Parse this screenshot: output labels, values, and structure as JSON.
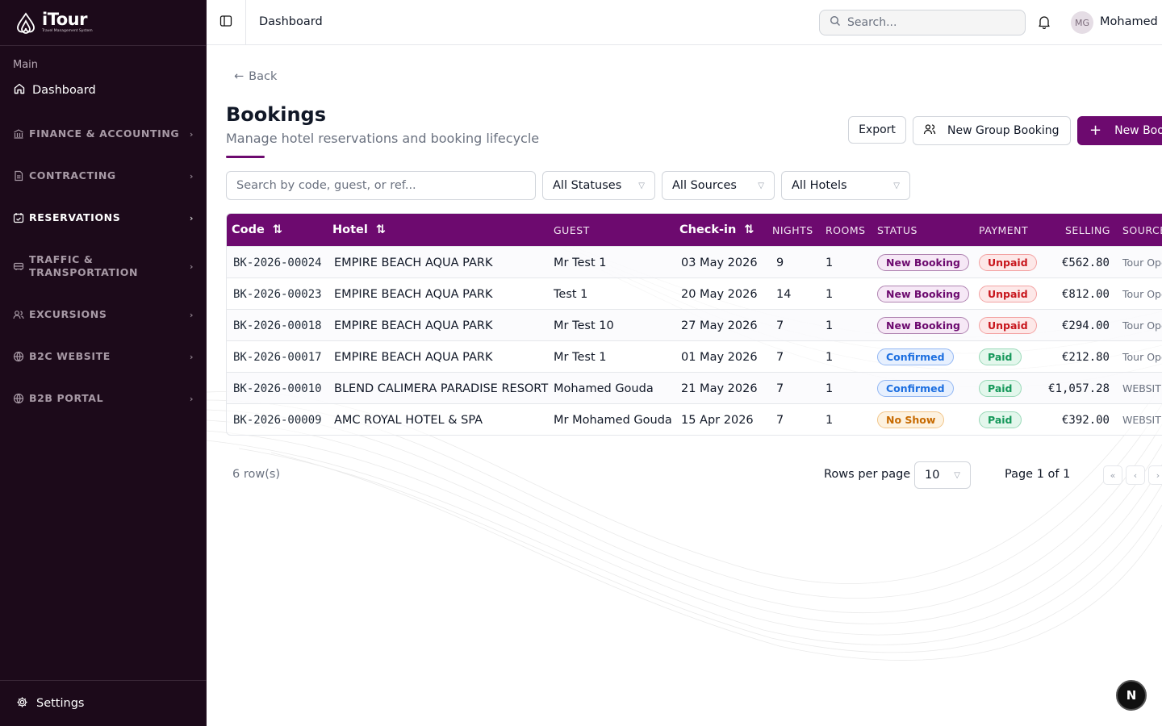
{
  "brand": {
    "name": "iTour",
    "tagline": "Travel Management System"
  },
  "sidebar": {
    "section_label": "Main",
    "dashboard_label": "Dashboard",
    "groups": [
      {
        "label": "FINANCE & ACCOUNTING",
        "icon": "bank-icon"
      },
      {
        "label": "CONTRACTING",
        "icon": "file-icon"
      },
      {
        "label": "RESERVATIONS",
        "icon": "calendar-check-icon"
      },
      {
        "label": "TRAFFIC &\nTRANSPORTATION",
        "icon": "bus-icon"
      },
      {
        "label": "EXCURSIONS",
        "icon": "users-icon"
      },
      {
        "label": "B2C WEBSITE",
        "icon": "globe-icon"
      },
      {
        "label": "B2B PORTAL",
        "icon": "globe-icon"
      }
    ],
    "settings_label": "Settings"
  },
  "header": {
    "breadcrumb": "Dashboard",
    "search_placeholder": "Search...",
    "avatar_initials": "MG",
    "user_name": "Mohamed Gouda"
  },
  "page": {
    "back_label": "Back",
    "title": "Bookings",
    "subtitle": "Manage hotel reservations and booking lifecycle",
    "export_label": "Export",
    "group_booking_label": "New Group Booking",
    "new_booking_label": "New Booking"
  },
  "filters": {
    "search_placeholder": "Search by code, guest, or ref...",
    "status": "All Statuses",
    "source": "All Sources",
    "hotel": "All Hotels"
  },
  "table": {
    "columns": {
      "code": "Code",
      "hotel": "Hotel",
      "guest": "GUEST",
      "checkin": "Check-in",
      "nights": "NIGHTS",
      "rooms": "ROOMS",
      "status": "STATUS",
      "payment": "PAYMENT",
      "selling": "SELLING",
      "source": "SOURCE"
    },
    "rows": [
      {
        "code": "BK-2026-00024",
        "hotel": "EMPIRE BEACH AQUA PARK",
        "guest": "Mr Test 1",
        "checkin": "03 May 2026",
        "nights": "9",
        "rooms": "1",
        "status": "New Booking",
        "payment": "Unpaid",
        "selling": "€562.80",
        "source": "Tour Operator"
      },
      {
        "code": "BK-2026-00023",
        "hotel": "EMPIRE BEACH AQUA PARK",
        "guest": "Test 1",
        "checkin": "20 May 2026",
        "nights": "14",
        "rooms": "1",
        "status": "New Booking",
        "payment": "Unpaid",
        "selling": "€812.00",
        "source": "Tour Operator"
      },
      {
        "code": "BK-2026-00018",
        "hotel": "EMPIRE BEACH AQUA PARK",
        "guest": "Mr Test 10",
        "checkin": "27 May 2026",
        "nights": "7",
        "rooms": "1",
        "status": "New Booking",
        "payment": "Unpaid",
        "selling": "€294.00",
        "source": "Tour Operator"
      },
      {
        "code": "BK-2026-00017",
        "hotel": "EMPIRE BEACH AQUA PARK",
        "guest": "Mr Test 1",
        "checkin": "01 May 2026",
        "nights": "7",
        "rooms": "1",
        "status": "Confirmed",
        "payment": "Paid",
        "selling": "€212.80",
        "source": "Tour Operator"
      },
      {
        "code": "BK-2026-00010",
        "hotel": "BLEND CALIMERA PARADISE RESORT",
        "guest": "Mohamed Gouda",
        "checkin": "21 May 2026",
        "nights": "7",
        "rooms": "1",
        "status": "Confirmed",
        "payment": "Paid",
        "selling": "€1,057.28",
        "source": "WEBSITE"
      },
      {
        "code": "BK-2026-00009",
        "hotel": "AMC ROYAL HOTEL & SPA",
        "guest": "Mr Mohamed Gouda",
        "checkin": "15 Apr 2026",
        "nights": "7",
        "rooms": "1",
        "status": "No Show",
        "payment": "Paid",
        "selling": "€392.00",
        "source": "WEBSITE"
      }
    ]
  },
  "pagination": {
    "row_count": "6 row(s)",
    "rows_per_page_label": "Rows per page",
    "rows_per_page": "10",
    "page_info": "Page 1 of 1"
  },
  "colors": {
    "brand": "#6d0a6f",
    "sidebar_bg": "#1c0a1a"
  }
}
